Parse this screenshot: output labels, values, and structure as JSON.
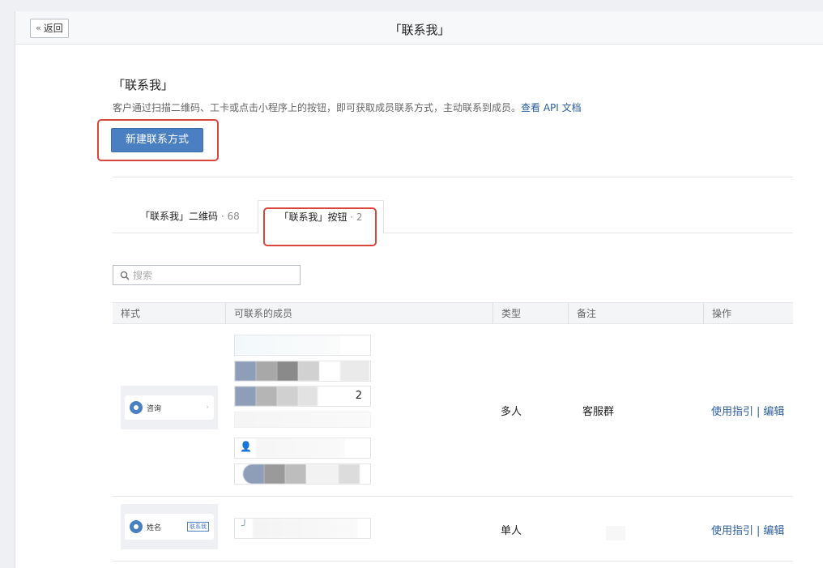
{
  "topbar": {
    "back_label": "返回",
    "title": "「联系我」"
  },
  "header": {
    "title": "「联系我」",
    "description": "客户通过扫描二维码、工卡或点击小程序上的按钮，即可获取成员联系方式，主动联系到成员。",
    "doc_link": "查看 API 文档",
    "new_button": "新建联系方式"
  },
  "tabs": [
    {
      "label": "「联系我」二维码",
      "count": "· 68"
    },
    {
      "label": "「联系我」按钮",
      "count": "· 2"
    }
  ],
  "search": {
    "placeholder": "搜索"
  },
  "table": {
    "columns": [
      "样式",
      "可联系的成员",
      "类型",
      "备注",
      "操作"
    ],
    "rows": [
      {
        "preview_label": "咨询",
        "type": "多人",
        "note": "客服群",
        "member_count_badge": "2",
        "op_guide": "使用指引",
        "op_edit": "编辑"
      },
      {
        "preview_label": "姓名",
        "preview_tag": "联系我",
        "type": "单人",
        "note": "",
        "op_guide": "使用指引",
        "op_edit": "编辑"
      }
    ]
  },
  "colors": {
    "accent": "#4a7fc1",
    "link": "#2b5d9b",
    "highlight": "#d9463b"
  }
}
